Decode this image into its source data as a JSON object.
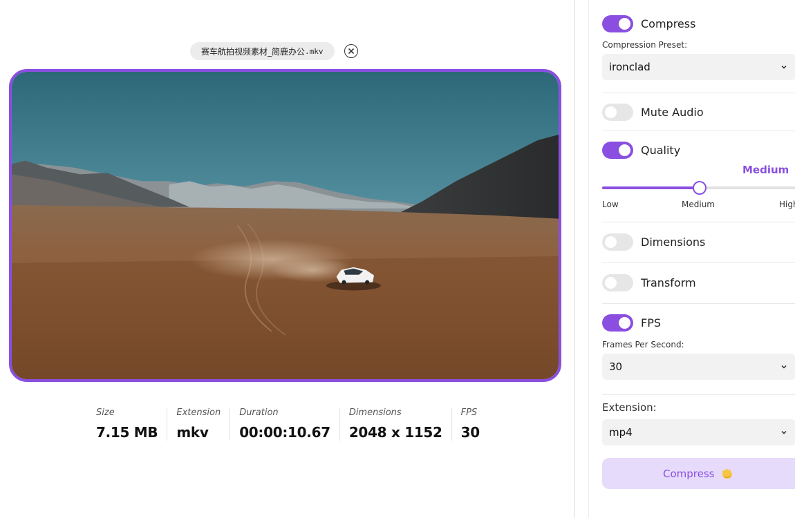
{
  "file": {
    "name": "赛车航拍视频素材_简鹿办公",
    "extension": ".mkv"
  },
  "meta": [
    {
      "label": "Size",
      "value": "7.15 MB"
    },
    {
      "label": "Extension",
      "value": "mkv"
    },
    {
      "label": "Duration",
      "value": "00:00:10.67"
    },
    {
      "label": "Dimensions",
      "value": "2048 x 1152"
    },
    {
      "label": "FPS",
      "value": "30"
    }
  ],
  "settings": {
    "compress": {
      "label": "Compress",
      "enabled": true,
      "preset_label": "Compression Preset:",
      "preset_value": "ironclad"
    },
    "mute_audio": {
      "label": "Mute Audio",
      "enabled": false
    },
    "quality": {
      "label": "Quality",
      "enabled": true,
      "level": "Medium",
      "value_fraction": 0.5,
      "ticks": [
        "Low",
        "Medium",
        "High"
      ]
    },
    "dimensions": {
      "label": "Dimensions",
      "enabled": false
    },
    "transform": {
      "label": "Transform",
      "enabled": false
    },
    "fps": {
      "label": "FPS",
      "enabled": true,
      "field_label": "Frames Per Second:",
      "value": "30"
    },
    "extension": {
      "label": "Extension:",
      "value": "mp4"
    },
    "compress_button": {
      "label": "Compress"
    }
  },
  "colors": {
    "accent": "#8a4fe0",
    "accent_light": "#e6dbfb"
  },
  "icons": {
    "remove": "close-circle-icon",
    "select": "chevron-down-icon",
    "button": "hand-wave-icon"
  }
}
